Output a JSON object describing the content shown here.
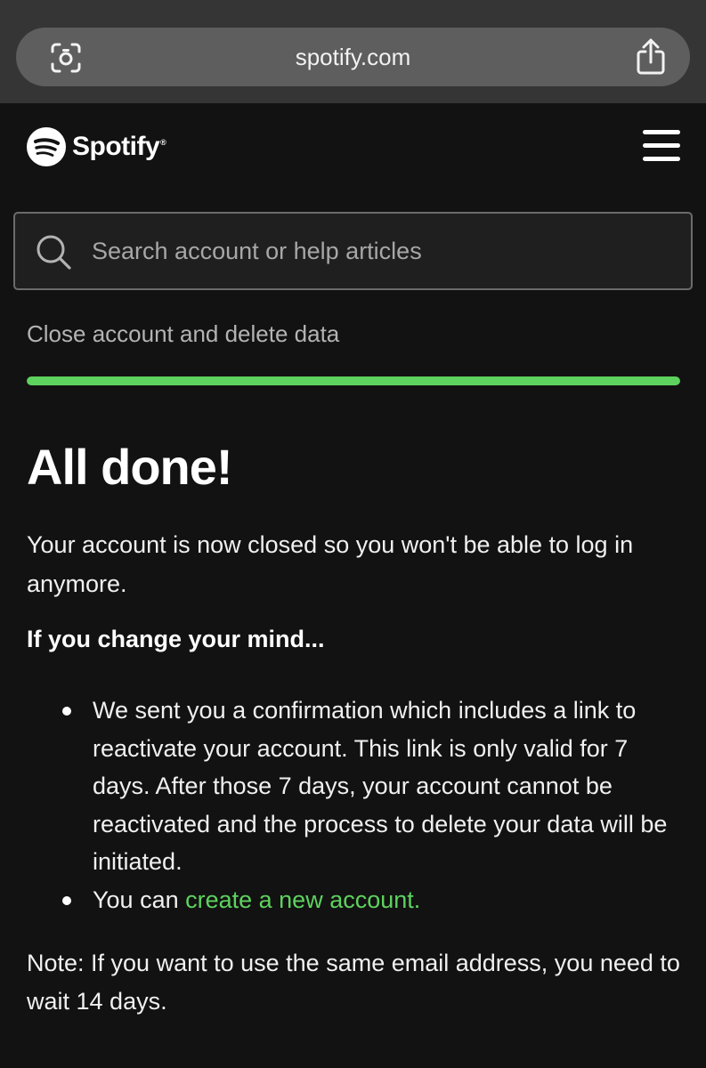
{
  "browser": {
    "url": "spotify.com",
    "icons": [
      "camera-scan-icon",
      "share-icon"
    ]
  },
  "header": {
    "brand": "Spotify",
    "brand_mark": "®",
    "icons": [
      "spotify-logo-icon",
      "hamburger-menu-icon"
    ]
  },
  "search": {
    "placeholder": "Search account or help articles",
    "value": "",
    "icon": "search-icon"
  },
  "breadcrumb": "Close account and delete data",
  "progress": {
    "percent": 100,
    "color": "#5ed25e"
  },
  "main": {
    "title": "All done!",
    "intro": "Your account is now closed so you won't be able to log in anymore.",
    "subheading": "If you change your mind...",
    "bullets": [
      {
        "text": "We sent you a confirmation which includes a link to reactivate your account. This link is only valid for 7 days. After those 7 days, your account cannot be reactivated and the process to delete your data will be initiated."
      },
      {
        "prefix": "You can ",
        "link": "create a new account."
      }
    ],
    "note": "Note: If you want to use the same email address, you need to wait 14 days."
  },
  "colors": {
    "background": "#121212",
    "accent": "#5ed25e",
    "browser_chrome": "#353535"
  }
}
